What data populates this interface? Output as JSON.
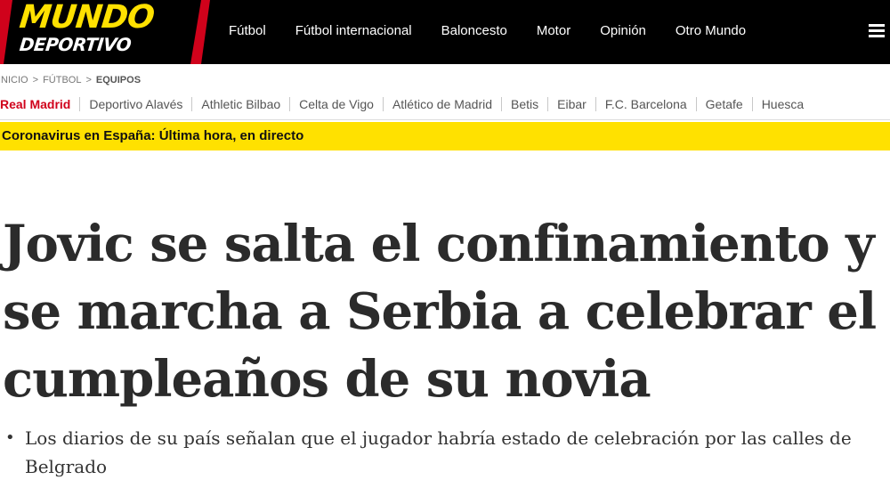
{
  "logo": {
    "line1": "MUNDO",
    "line2": "DEPORTIVO"
  },
  "nav": {
    "items": [
      "Fútbol",
      "Fútbol internacional",
      "Baloncesto",
      "Motor",
      "Opinión",
      "Otro Mundo"
    ]
  },
  "breadcrumb": {
    "items": [
      "INICIO",
      "FÚTBOL",
      "EQUIPOS"
    ],
    "separator": ">"
  },
  "teams": {
    "items": [
      "Real Madrid",
      "Deportivo Alavés",
      "Athletic Bilbao",
      "Celta de Vigo",
      "Atlético de Madrid",
      "Betis",
      "Eibar",
      "F.C. Barcelona",
      "Getafe",
      "Huesca"
    ],
    "active": "Real Madrid"
  },
  "banner": {
    "text": "Coronavirus en España: Última hora, en directo"
  },
  "article": {
    "headline": "Jovic se salta el confinamiento y se marcha a Serbia a celebrar el cumpleaños de su novia",
    "subtitle_bullet": "•",
    "subtitle": "Los diarios de su país señalan que el jugador habría estado de celebración por las calles de Belgrado"
  },
  "colors": {
    "brand_red": "#d0021b",
    "brand_yellow": "#ffe100",
    "header_bg": "#000000"
  },
  "icons": {
    "menu": "hamburger-menu-icon"
  }
}
